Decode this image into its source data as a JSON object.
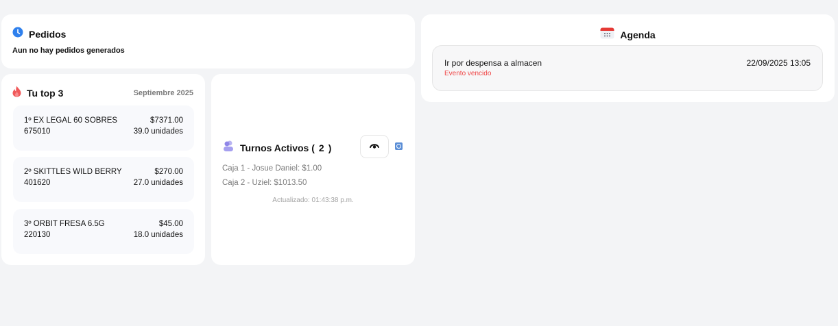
{
  "pedidos": {
    "title": "Pedidos",
    "icon": "clock-icon",
    "empty_text": "Aun no hay pedidos generados"
  },
  "top3": {
    "title": "Tu top 3",
    "icon": "fire-icon",
    "period": "Septiembre 2025",
    "items": [
      {
        "name": "1º EX LEGAL 60 SOBRES",
        "price": "$7371.00",
        "code": "675010",
        "units": "39.0 unidades"
      },
      {
        "name": "2º SKITTLES WILD BERRY",
        "price": "$270.00",
        "code": "401620",
        "units": "27.0 unidades"
      },
      {
        "name": "3º ORBIT FRESA 6.5G",
        "price": "$45.00",
        "code": "220130",
        "units": "18.0 unidades"
      }
    ]
  },
  "turnos": {
    "title_prefix": "Turnos Activos (",
    "count": "2",
    "title_suffix": ")",
    "icon": "users-icon",
    "cajas": [
      "Caja 1 - Josue Daniel: $1.00",
      "Caja 2 - Uziel: $1013.50"
    ],
    "updated": "Actualizado: 01:43:38 p.m."
  },
  "agenda": {
    "title": "Agenda",
    "icon": "calendar-icon",
    "event": {
      "name": "Ir por despensa a almacen",
      "date": "22/09/2025 13:05",
      "status": "Evento vencido"
    }
  },
  "colors": {
    "background": "#f3f4f6",
    "card": "#ffffff",
    "accent_blue": "#2f80ed",
    "overdue_red": "#ef4444",
    "muted_text": "#7b7b7b"
  }
}
